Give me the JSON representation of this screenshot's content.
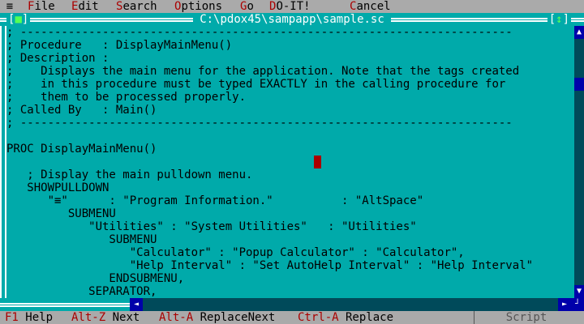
{
  "menu": {
    "system": "≡",
    "items": [
      {
        "hot": "F",
        "rest": "ile"
      },
      {
        "hot": "E",
        "rest": "dit"
      },
      {
        "hot": "S",
        "rest": "earch"
      },
      {
        "hot": "O",
        "rest": "ptions"
      },
      {
        "hot": "G",
        "rest": "o"
      },
      {
        "hot": "D",
        "rest": "O-IT!"
      },
      {
        "hot": "C",
        "rest": "ancel"
      }
    ]
  },
  "window": {
    "title": "C:\\pdox45\\sampapp\\sample.sc",
    "close_box": "■",
    "maximize_box": "↕"
  },
  "editor": {
    "lines": [
      "; ------------------------------------------------------------------------",
      "; Procedure   : DisplayMainMenu()",
      "; Description :",
      ";    Displays the main menu for the application. Note that the tags created",
      ";    in this procedure must be typed EXACTLY in the calling procedure for",
      ";    them to be processed properly.",
      "; Called By   : Main()",
      "; ------------------------------------------------------------------------",
      "",
      "PROC DisplayMainMenu()",
      "",
      "",
      "   ; Display the main pulldown menu.",
      "   SHOWPULLDOWN",
      "      \"≡\"      : \"Program Information.\"          : \"AltSpace\"",
      "         SUBMENU",
      "            \"Utilities\" : \"System Utilities\"   : \"Utilities\"",
      "               SUBMENU",
      "                  \"Calculator\" : \"Popup Calculator\" : \"Calculator\",",
      "                  \"Help Interval\" : \"Set AutoHelp Interval\" : \"Help Interval\"",
      "               ENDSUBMENU,",
      "            SEPARATOR,"
    ]
  },
  "statusbar": {
    "items": [
      {
        "key": "F1",
        "label": " Help"
      },
      {
        "key": "Alt-Z",
        "label": " Next"
      },
      {
        "key": "Alt-A",
        "label": " ReplaceNext"
      },
      {
        "key": "Ctrl-A",
        "label": " Replace"
      }
    ],
    "mode": "Script"
  },
  "colors": {
    "background": "#00aaaa",
    "menubar": "#aaaaaa",
    "hotkey": "#aa0000",
    "cursor": "#aa0000",
    "scroll": "#0000aa"
  }
}
